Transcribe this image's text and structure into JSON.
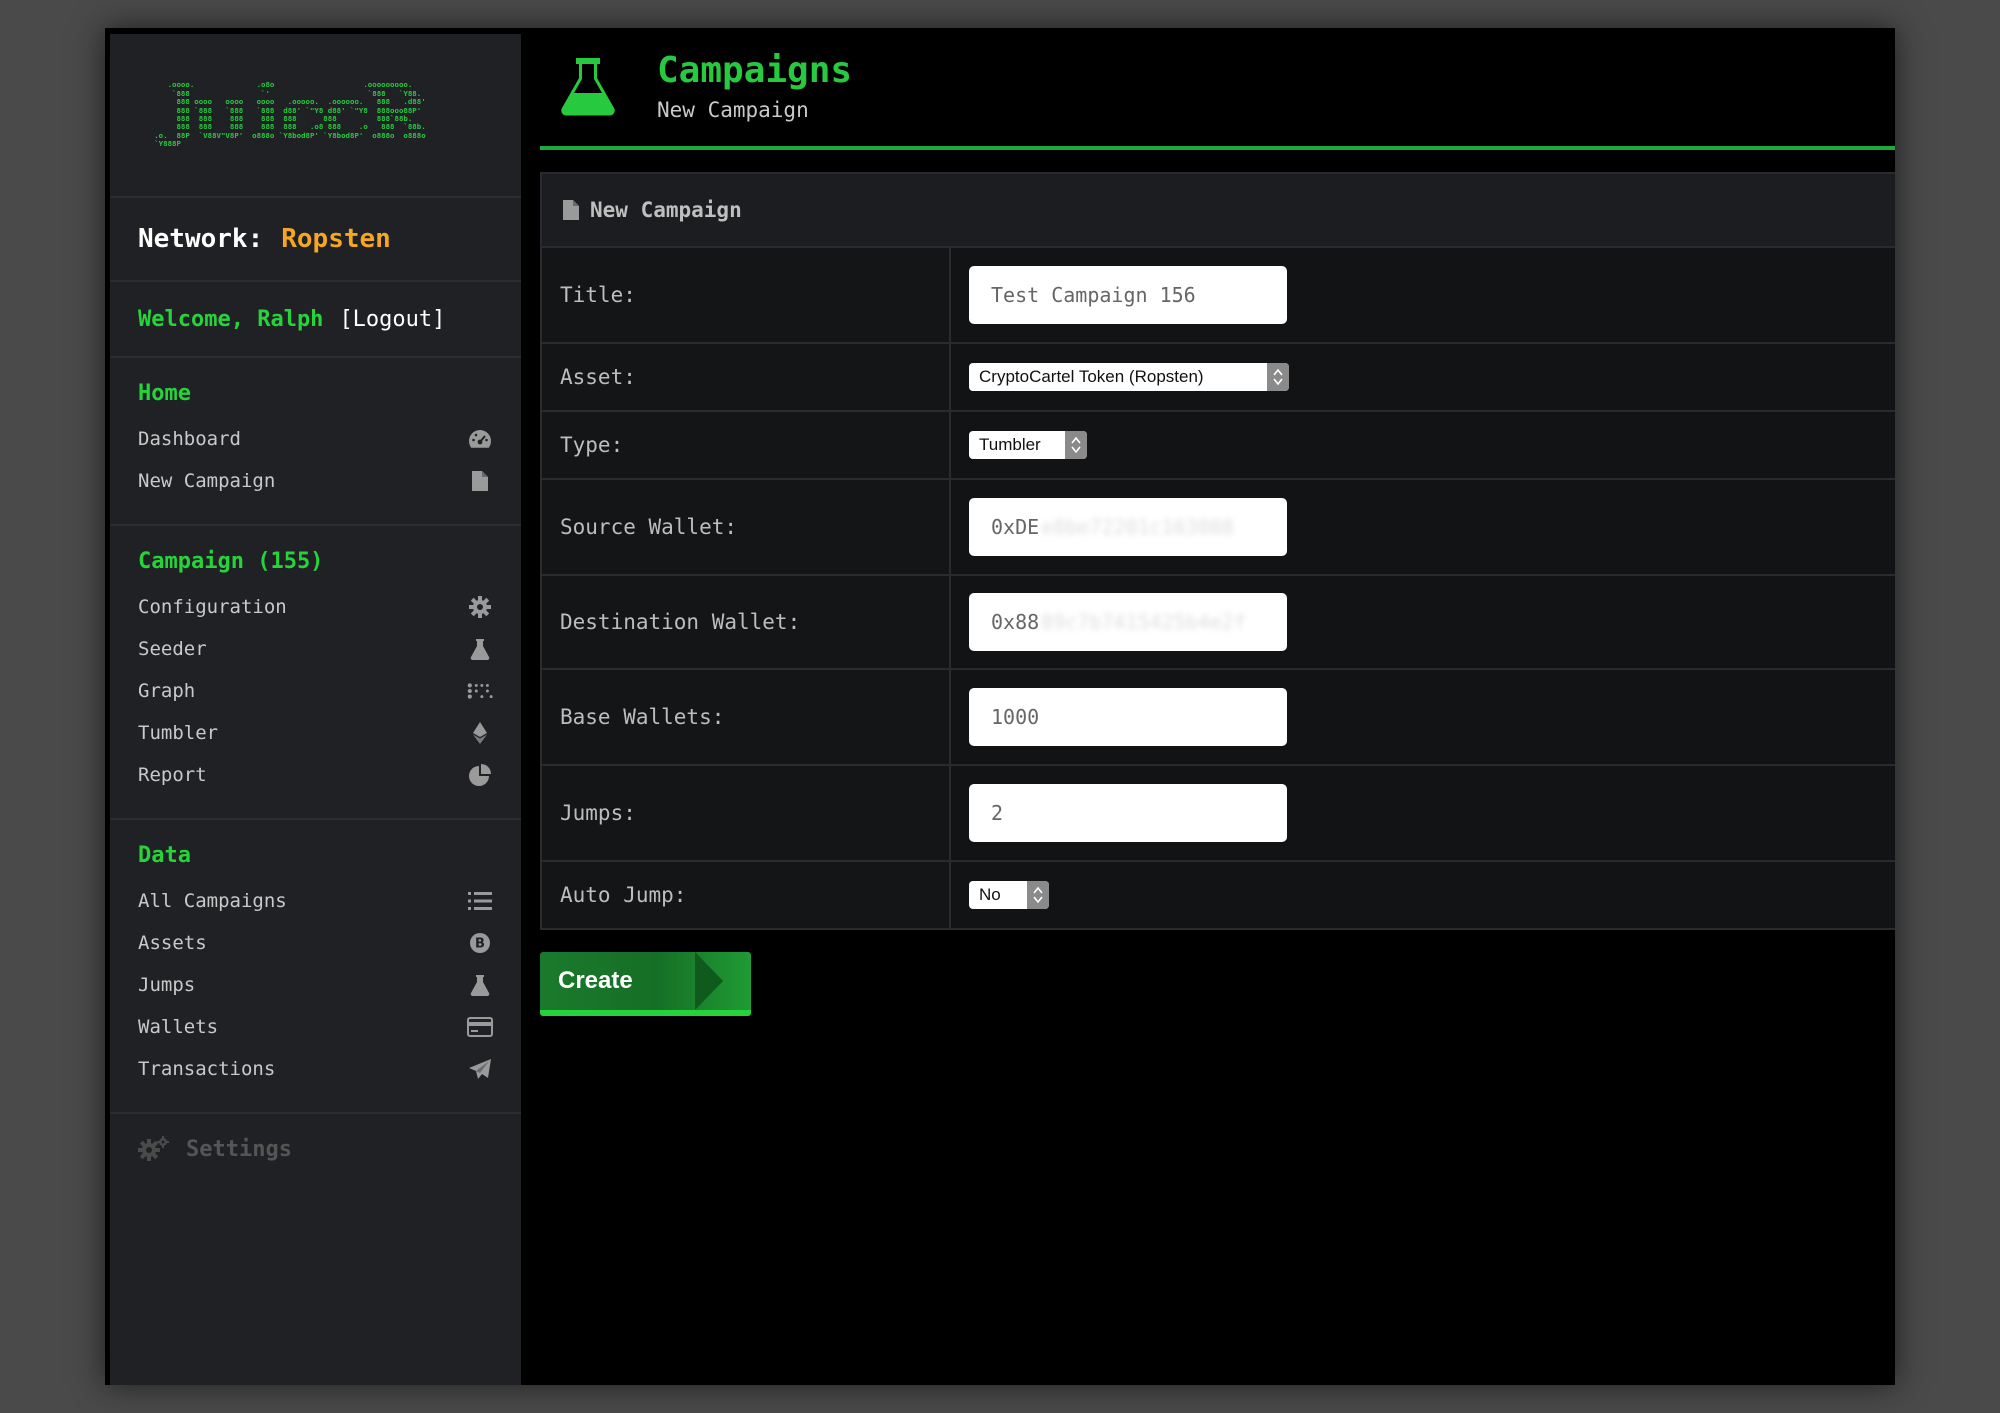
{
  "logo": {
    "ascii_lines": [
      "     .oooo.              .o8o                    .ooooooooo.",
      "      `888                `'                      `888   `Y88.",
      "       888 oooo   oooo   oooo   .ooooo.  .oooooo.   888   .d88'",
      "       888 `888   `888   `888  d88' `\"Y8 d88' `\"Y8  888ooo88P'",
      "       888  888    888    888  888      888         888`88b.",
      "       888  888    888    888  888   .o8 888    .o   888  `88b.",
      "  .o.  88P  `V88V\"V8P'  o888o `Y8bod8P' `Y8bod8P'  o888o  o888o",
      "  `Y888P"
    ]
  },
  "sidebar": {
    "network_label": "Network:",
    "network_value": "Ropsten",
    "welcome": "Welcome, Ralph",
    "logout": "[Logout]",
    "sections": [
      {
        "heading": "Home",
        "items": [
          {
            "label": "Dashboard",
            "icon": "dashboard-icon"
          },
          {
            "label": "New Campaign",
            "icon": "file-icon"
          }
        ]
      },
      {
        "heading": "Campaign (155)",
        "items": [
          {
            "label": "Configuration",
            "icon": "gear-icon"
          },
          {
            "label": "Seeder",
            "icon": "flask-icon"
          },
          {
            "label": "Graph",
            "icon": "graph-icon"
          },
          {
            "label": "Tumbler",
            "icon": "ethereum-icon"
          },
          {
            "label": "Report",
            "icon": "pie-chart-icon"
          }
        ]
      },
      {
        "heading": "Data",
        "items": [
          {
            "label": "All Campaigns",
            "icon": "list-icon"
          },
          {
            "label": "Assets",
            "icon": "bitcoin-icon"
          },
          {
            "label": "Jumps",
            "icon": "flask-icon"
          },
          {
            "label": "Wallets",
            "icon": "credit-card-icon"
          },
          {
            "label": "Transactions",
            "icon": "paper-plane-icon"
          }
        ]
      }
    ],
    "settings": "Settings"
  },
  "header": {
    "title": "Campaigns",
    "subtitle": "New Campaign"
  },
  "form": {
    "panel_title": "New Campaign",
    "title_label": "Title:",
    "title_value": "Test Campaign 156",
    "asset_label": "Asset:",
    "asset_value": "CryptoCartel Token (Ropsten)",
    "type_label": "Type:",
    "type_value": "Tumbler",
    "source_label": "Source Wallet:",
    "source_prefix": "0xDE",
    "source_redacted": "e8be72201c163088",
    "dest_label": "Destination Wallet:",
    "dest_prefix": "0x88",
    "dest_redacted": "89c7b7415425b4e2f",
    "base_label": "Base Wallets:",
    "base_value": "1000",
    "jumps_label": "Jumps:",
    "jumps_value": "2",
    "auto_label": "Auto Jump:",
    "auto_value": "No",
    "create_label": "Create"
  },
  "colors": {
    "accent_green": "#27d33a",
    "network_orange": "#f5a623",
    "sidebar_bg": "#202124",
    "main_bg": "#000000"
  }
}
